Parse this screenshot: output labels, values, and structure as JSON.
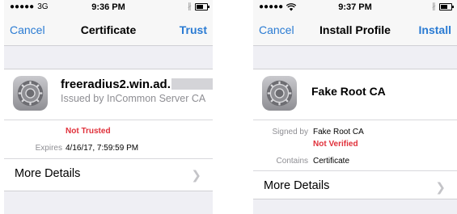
{
  "left": {
    "status": {
      "carrier": "3G",
      "time": "9:36 PM"
    },
    "nav": {
      "cancel": "Cancel",
      "title": "Certificate",
      "action": "Trust"
    },
    "profile": {
      "title": "freeradius2.win.ad.",
      "subtitle": "Issued by InCommon Server CA"
    },
    "trust_status": "Not Trusted",
    "expires": {
      "label": "Expires",
      "value": "4/16/17, 7:59:59 PM"
    },
    "more_details": "More Details"
  },
  "right": {
    "status": {
      "time": "9:37 PM"
    },
    "nav": {
      "cancel": "Cancel",
      "title": "Install Profile",
      "action": "Install"
    },
    "profile": {
      "title": "Fake Root CA"
    },
    "signed_by": {
      "label": "Signed by",
      "value": "Fake Root CA",
      "status": "Not Verified"
    },
    "contains": {
      "label": "Contains",
      "value": "Certificate"
    },
    "more_details": "More Details"
  },
  "colors": {
    "accent": "#2a7bd3",
    "warning": "#e0303a",
    "secondary_text": "#8e8e93",
    "background": "#efeff4"
  },
  "icons": [
    "signal-dots-icon",
    "bluetooth-icon",
    "battery-icon",
    "wifi-icon",
    "settings-gear-icon",
    "chevron-right-icon"
  ]
}
